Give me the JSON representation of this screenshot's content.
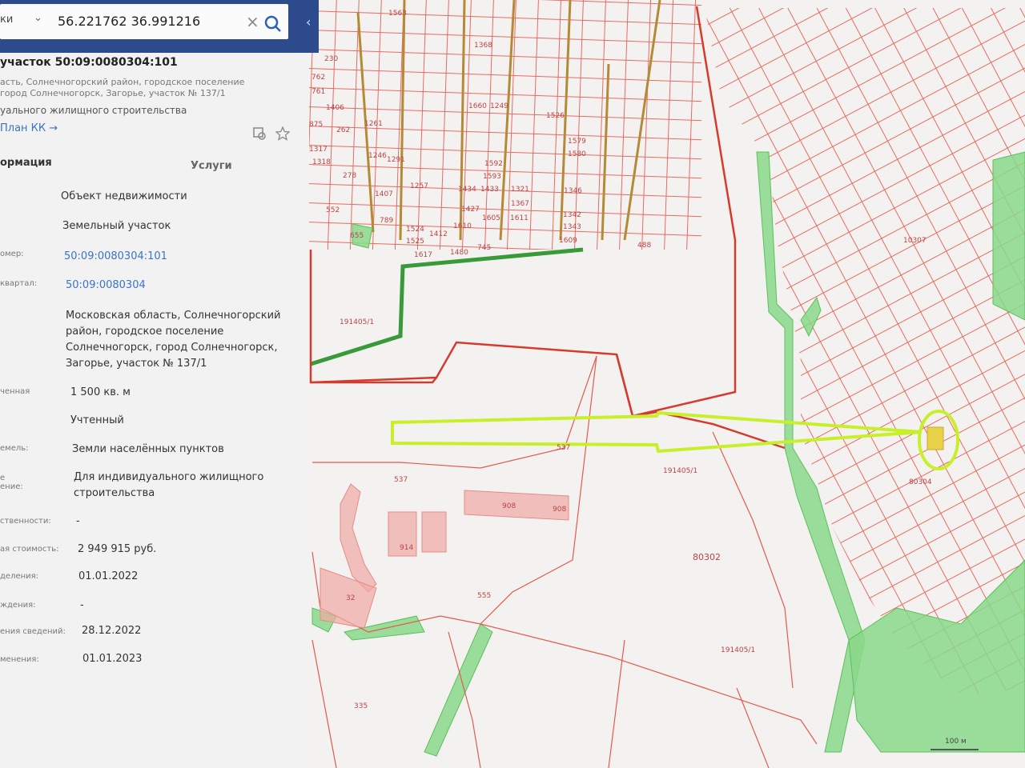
{
  "search": {
    "prefix": "ки",
    "value": "56.221762 36.991216"
  },
  "parcel": {
    "title": "участок 50:09:0080304:101",
    "address_lines": [
      "асть, Солнечногорский район, городское поселение",
      "город Солнечногорск, Загорье, участок № 137/1",
      "уального жилищного строительства"
    ],
    "plan_link": "План КК →"
  },
  "tabs": {
    "info": "ормация",
    "services": "Услуги"
  },
  "rows": [
    {
      "label": "",
      "value": "Объект недвижимости"
    },
    {
      "label": "",
      "value": "Земельный участок"
    },
    {
      "label": "омер:",
      "value": "50:09:0080304:101",
      "link": true
    },
    {
      "label": "квартал:",
      "value": "50:09:0080304",
      "link": true
    },
    {
      "label": "",
      "value": "Московская область, Солнечногорский район, городское поселение Солнечногорск, город Солнечногорск, Загорье, участок № 137/1"
    },
    {
      "label": "ченная",
      "value": "1 500 кв. м"
    },
    {
      "label": "",
      "value": "Учтенный"
    },
    {
      "label": "емель:",
      "value": "Земли населённых пунктов"
    },
    {
      "label": "е\nение:",
      "value": "Для индивидуального жилищного строительства"
    },
    {
      "label": "ственности:",
      "value": "-"
    },
    {
      "label": "ая стоимость:",
      "value": "2 949 915 руб."
    },
    {
      "label": "деления:",
      "value": "01.01.2022"
    },
    {
      "label": "ждения:",
      "value": "-"
    },
    {
      "label": "ения сведений:",
      "value": "28.12.2022"
    },
    {
      "label": "менения:",
      "value": "01.01.2023"
    }
  ],
  "map": {
    "labels": [
      "191405/1",
      "191405/1",
      "191405/1",
      "537",
      "537",
      "908",
      "908",
      "80302",
      "80304",
      "10307",
      "32",
      "914",
      "555",
      "335",
      "1563",
      "1368",
      "1660",
      "1249",
      "1526",
      "1346",
      "1610",
      "1617",
      "1480",
      "745",
      "1609",
      "488",
      "762",
      "761",
      "1406",
      "875",
      "1317",
      "1318",
      "230",
      "262",
      "278",
      "552",
      "655",
      "789",
      "1407",
      "1412",
      "1525",
      "1524",
      "1433",
      "1434",
      "1342",
      "1343",
      "1611",
      "1321",
      "1367",
      "1593",
      "1592",
      "1427",
      "1605",
      "1579",
      "1580",
      "1261",
      "1257",
      "1246",
      "1291"
    ],
    "scale": "100 м",
    "colors": {
      "boundary": "#d63a2c",
      "parcel_line": "#e86a60",
      "green_zone": "#7ed67e",
      "highlight": "#c8f02a",
      "target_fill": "#e8d24a",
      "panel_header": "#2c4a8c"
    }
  }
}
